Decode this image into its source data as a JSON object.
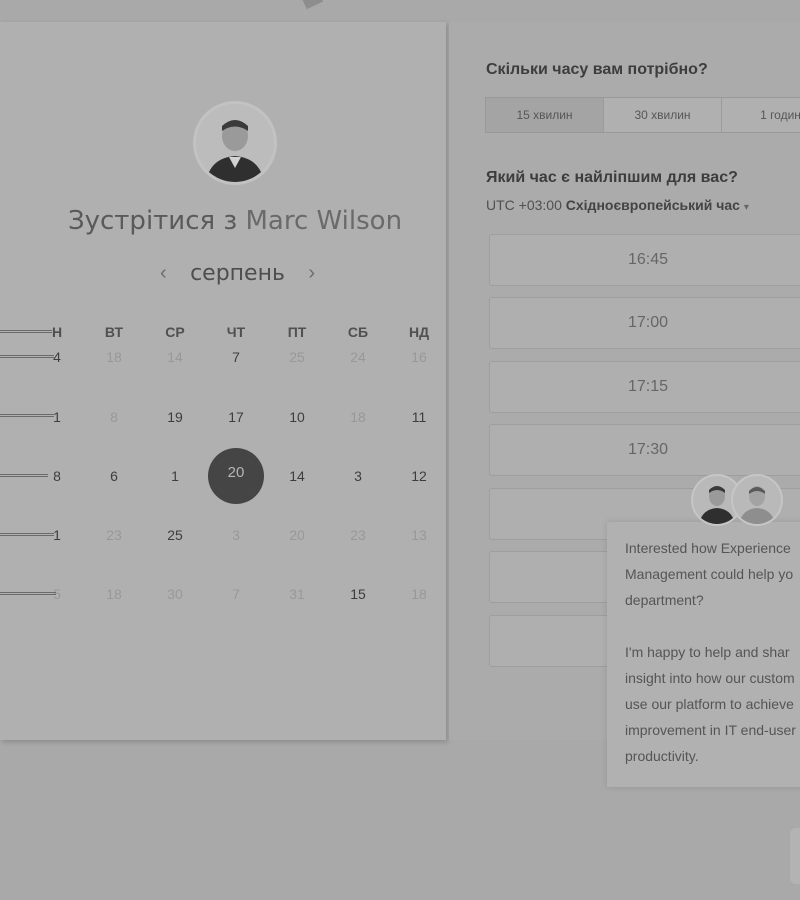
{
  "meeting": {
    "prefix": "Зустрітися з",
    "name": "Marc Wilson"
  },
  "calendar": {
    "month": "серпень",
    "weekdays": [
      "Н",
      "ВТ",
      "СР",
      "ЧТ",
      "ПТ",
      "СБ",
      "НД"
    ],
    "rows": [
      [
        {
          "t": "4",
          "dim": false
        },
        {
          "t": "18",
          "dim": true
        },
        {
          "t": "14",
          "dim": true
        },
        {
          "t": "7",
          "dim": false
        },
        {
          "t": "25",
          "dim": true
        },
        {
          "t": "24",
          "dim": true
        },
        {
          "t": "16",
          "dim": true
        }
      ],
      [
        {
          "t": "1",
          "dim": false
        },
        {
          "t": "8",
          "dim": true
        },
        {
          "t": "19",
          "dim": false
        },
        {
          "t": "17",
          "dim": false
        },
        {
          "t": "10",
          "dim": false
        },
        {
          "t": "18",
          "dim": true
        },
        {
          "t": "11",
          "dim": false
        }
      ],
      [
        {
          "t": "8",
          "dim": false
        },
        {
          "t": "6",
          "dim": false
        },
        {
          "t": "1",
          "dim": false
        },
        {
          "t": "20",
          "dim": false,
          "selected": true
        },
        {
          "t": "14",
          "dim": false
        },
        {
          "t": "3",
          "dim": false
        },
        {
          "t": "12",
          "dim": false
        }
      ],
      [
        {
          "t": "1",
          "dim": false
        },
        {
          "t": "23",
          "dim": true
        },
        {
          "t": "25",
          "dim": false
        },
        {
          "t": "3",
          "dim": true
        },
        {
          "t": "20",
          "dim": true
        },
        {
          "t": "23",
          "dim": true
        },
        {
          "t": "13",
          "dim": true
        }
      ],
      [
        {
          "t": "5",
          "dim": true
        },
        {
          "t": "18",
          "dim": true
        },
        {
          "t": "30",
          "dim": true
        },
        {
          "t": "7",
          "dim": true
        },
        {
          "t": "31",
          "dim": true
        },
        {
          "t": "15",
          "dim": false
        },
        {
          "t": "18",
          "dim": true
        }
      ]
    ]
  },
  "duration": {
    "title": "Скільки часу вам потрібно?",
    "options": [
      "15 хвилин",
      "30 хвилин",
      "1 годин"
    ],
    "selected_index": 0
  },
  "time": {
    "title": "Який час є найліпшим для вас?",
    "tz_offset": "UTC +03:00",
    "tz_name": "Східноєвропейський час",
    "tz_caret": "▾",
    "slots": [
      "16:45",
      "17:00",
      "17:15",
      "17:30",
      "",
      "",
      ""
    ]
  },
  "chat": {
    "lines": [
      "Interested how Experience",
      "Management could help yo",
      "department?",
      "",
      "I'm happy to help and shar",
      "insight into how our custom",
      "use our platform to achieve",
      "improvement in IT end-user",
      "productivity."
    ]
  }
}
